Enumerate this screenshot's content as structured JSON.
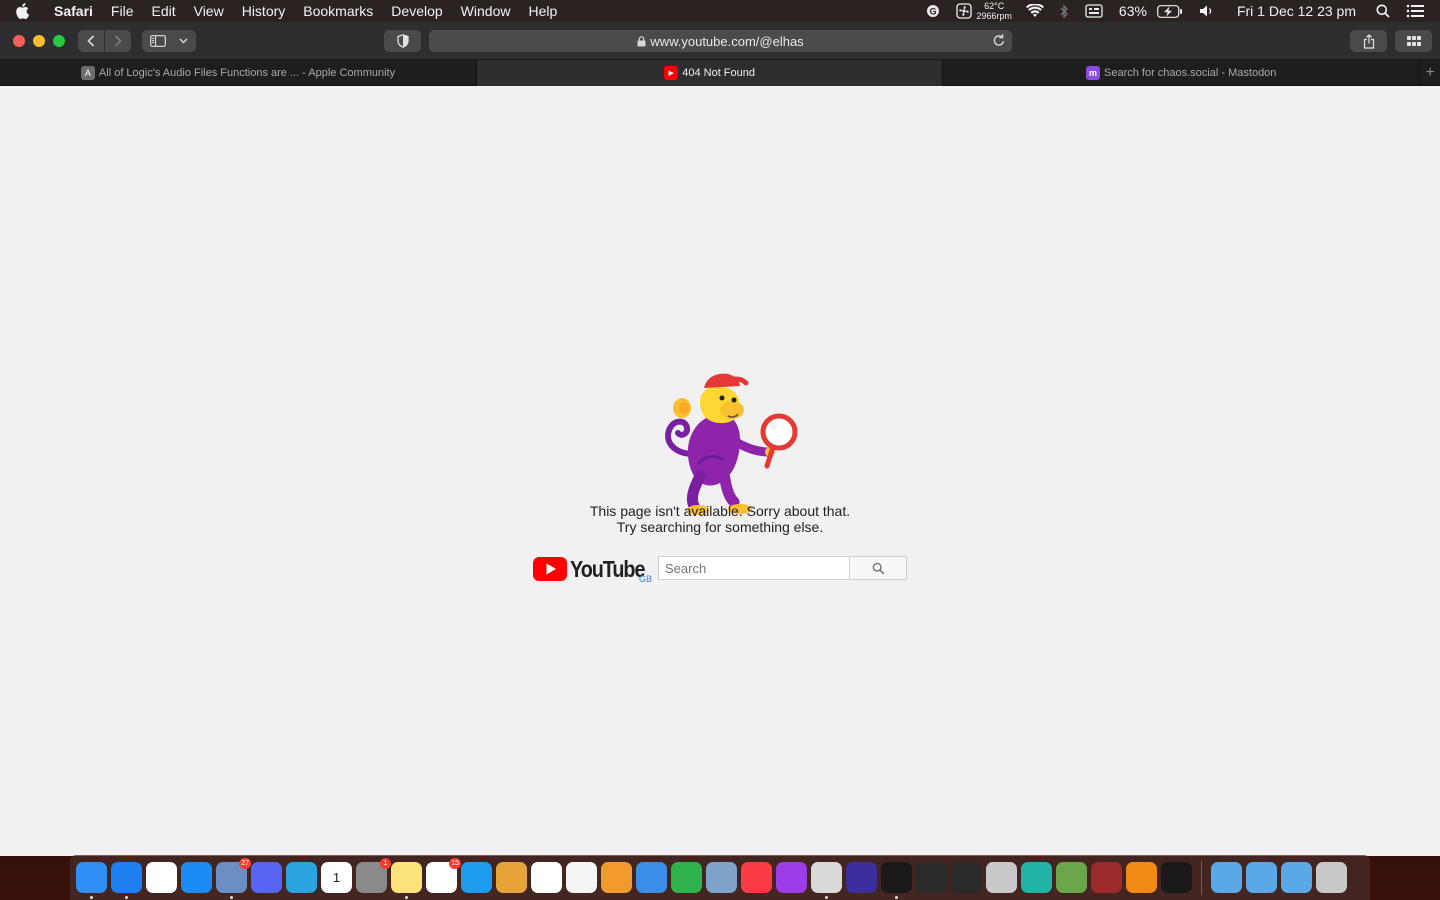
{
  "menubar": {
    "app_name": "Safari",
    "menus": [
      "File",
      "Edit",
      "View",
      "History",
      "Bookmarks",
      "Develop",
      "Window",
      "Help"
    ],
    "temperature": "62°C",
    "fan_speed": "2966rpm",
    "battery_percent": "63%",
    "clock": "Fri 1 Dec  12 23 pm"
  },
  "toolbar": {
    "url": "www.youtube.com/@elhas"
  },
  "tabs": [
    {
      "title": "All of Logic's Audio Files Functions are ... - Apple Community",
      "favicon_letter": "A",
      "active": false
    },
    {
      "title": "404 Not Found",
      "favicon_letter": "▶",
      "active": true
    },
    {
      "title": "Search for chaos.social - Mastodon",
      "favicon_letter": "m",
      "active": false
    }
  ],
  "page": {
    "error_line1": "This page isn't available. Sorry about that.",
    "error_line2": "Try searching for something else.",
    "logo_text": "YouTube",
    "region_code": "GB",
    "search_placeholder": "Search"
  },
  "dock": {
    "apps": [
      {
        "name": "Finder",
        "icon": "finder-icon",
        "color": "#2f8ff5",
        "running": true
      },
      {
        "name": "Safari",
        "icon": "safari-icon",
        "color": "#1e7ff0",
        "running": true
      },
      {
        "name": "Chrome",
        "icon": "chrome-icon",
        "color": "#ffffff",
        "running": false
      },
      {
        "name": "App Store",
        "icon": "app-store-icon",
        "color": "#1b8cf3",
        "running": false
      },
      {
        "name": "Mail Stamp",
        "icon": "mail-icon",
        "color": "#6b8fc2",
        "badge": "27",
        "running": true
      },
      {
        "name": "Discord",
        "icon": "discord-icon",
        "color": "#5865f2",
        "running": false
      },
      {
        "name": "Telegram",
        "icon": "telegram-icon",
        "color": "#2aa3df",
        "running": false
      },
      {
        "name": "Calendar",
        "icon": "calendar-icon",
        "color": "#ffffff",
        "label": "1",
        "running": false
      },
      {
        "name": "System Preferences",
        "icon": "gear-icon",
        "color": "#8a8a8a",
        "badge": "1",
        "running": false
      },
      {
        "name": "Notes",
        "icon": "notes-icon",
        "color": "#fbe27a",
        "running": true
      },
      {
        "name": "Reminders",
        "icon": "reminders-icon",
        "color": "#ffffff",
        "badge": "15",
        "running": false
      },
      {
        "name": "Affinity",
        "icon": "affinity-icon",
        "color": "#1e9df0",
        "running": false
      },
      {
        "name": "Pineapple App",
        "icon": "pineapple-icon",
        "color": "#e5a33a",
        "running": false
      },
      {
        "name": "Photos",
        "icon": "photos-icon",
        "color": "#ffffff",
        "running": false
      },
      {
        "name": "TextEdit",
        "icon": "textedit-icon",
        "color": "#f5f5f5",
        "running": false
      },
      {
        "name": "Pages",
        "icon": "pages-icon",
        "color": "#f29b2c",
        "running": false
      },
      {
        "name": "Keynote",
        "icon": "keynote-icon",
        "color": "#3a8ee8",
        "running": false
      },
      {
        "name": "Numbers",
        "icon": "numbers-icon",
        "color": "#2fb24c",
        "running": false
      },
      {
        "name": "Preview",
        "icon": "preview-icon",
        "color": "#7ea2c8",
        "running": false
      },
      {
        "name": "Music",
        "icon": "music-icon",
        "color": "#fc3c44",
        "running": false
      },
      {
        "name": "Podcasts",
        "icon": "podcasts-icon",
        "color": "#9b3ce6",
        "running": false
      },
      {
        "name": "Disk Utility",
        "icon": "disk-icon",
        "color": "#d9d9d9",
        "running": true
      },
      {
        "name": "Audio App",
        "icon": "headphones-icon",
        "color": "#3b2f9e",
        "running": false
      },
      {
        "name": "Activity Monitor",
        "icon": "activity-icon",
        "color": "#1a1a1a",
        "running": true
      },
      {
        "name": "Quicktime",
        "icon": "quicktime-icon",
        "color": "#2c2c2c",
        "running": false
      },
      {
        "name": "OBS",
        "icon": "obs-icon",
        "color": "#2b2b2b",
        "running": false
      },
      {
        "name": "Automator",
        "icon": "automator-icon",
        "color": "#c9c9c9",
        "running": false
      },
      {
        "name": "Screen App",
        "icon": "screen-icon",
        "color": "#21b3a8",
        "running": false
      },
      {
        "name": "Minecraft",
        "icon": "minecraft-icon",
        "color": "#6aa74b",
        "running": false
      },
      {
        "name": "Dictionary",
        "icon": "dictionary-icon",
        "color": "#9e2b2b",
        "running": false
      },
      {
        "name": "VLC",
        "icon": "vlc-icon",
        "color": "#f08a13",
        "running": false
      },
      {
        "name": "Terminal",
        "icon": "terminal-icon",
        "color": "#1a1a1a",
        "running": false
      }
    ],
    "folders": [
      {
        "name": "Applications",
        "icon": "applications-folder-icon",
        "color": "#5aa8e6"
      },
      {
        "name": "Utilities",
        "icon": "utilities-folder-icon",
        "color": "#5aa8e6"
      },
      {
        "name": "Downloads",
        "icon": "downloads-folder-icon",
        "color": "#5aa8e6"
      },
      {
        "name": "Trash",
        "icon": "trash-icon",
        "color": "#c8c8c8"
      }
    ]
  }
}
